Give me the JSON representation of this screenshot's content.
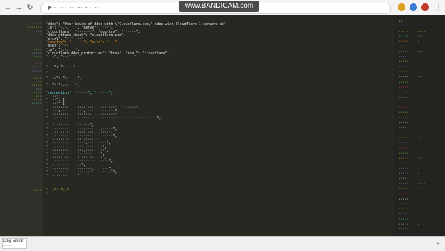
{
  "browser": {
    "back_icon": "back-arrow-icon",
    "forward_icon": "forward-arrow-icon",
    "reload_icon": "reload-icon",
    "address": "▶   ·   ··· ·· ······· ·· ·· ···",
    "watermark": "www.BANDICAM.com",
    "menu_label": "⋮",
    "ext_colors": [
      "#e0a020",
      "#3b78d8",
      "#c0392b"
    ]
  },
  "editor": {
    "background": "#272822",
    "lines": [
      {
        "num": "",
        "key": "",
        "key_color": "#a6e22e",
        "text": "{",
        "text_color": "#e6e6e6"
      },
      {
        "num": "",
        "key": "····",
        "key_color": "#a6e22e",
        "text": "\"ddos\": \"Your house of ddos with \\\"Cloudflare.com\\\" ddos with Cloudflare 1 servers at\"",
        "text_color": "#e6e6e6"
      },
      {
        "num": "",
        "key": "·······",
        "key_color": "#a6e22e",
        "text": "  \"ip\": \"·.·.·.·\", \"server\": \"··\",",
        "text_color": "#e6e6e6"
      },
      {
        "num": "",
        "key": "···",
        "key_color": "#66d9ef",
        "text": "\"cloudflare\": \"·······\", \"country\": \"······\",",
        "text_color": "#e6e6e6"
      },
      {
        "num": "",
        "key": "··",
        "key_color": "#66d9ef",
        "text": "\"ddos_attack_check\": \"cloudflare.com\",",
        "text_color": "#e6e6e6"
      },
      {
        "num": "",
        "key": "",
        "key_color": "#a6e22e",
        "text": "\"proxy\": \"·······\"",
        "text_color": "#e6e6e6"
      },
      {
        "num": "",
        "key": "···",
        "key_color": "#f92672",
        "text": "\"country\": \"······\", \"city\": \"···\",",
        "text_color": "#fd971f"
      },
      {
        "num": "",
        "key": "",
        "key_color": "#a6e22e",
        "text": "\"user\": \"····\",",
        "text_color": "#e6e6e6"
      },
      {
        "num": "",
        "key": "····",
        "key_color": "#a6e22e",
        "text": "\"ip\": \"·.·.·.·\",",
        "text_color": "#e6e6e6"
      },
      {
        "num": "",
        "key": "·····",
        "key_color": "#66d9ef",
        "text": "\"cloudflare_ddos_protection\": \"true\", \"cdn_\": \"cloudflare\",",
        "text_color": "#e6e6e6"
      },
      {
        "num": "",
        "key": "····",
        "key_color": "#a6e22e",
        "text": "\"···\": \"·····\"",
        "text_color": "#e6e6e6"
      },
      {
        "num": "",
        "key": "",
        "key_color": "#a6e22e",
        "text": "",
        "text_color": "#e6e6e6"
      },
      {
        "num": "",
        "key": "···",
        "key_color": "#f92672",
        "text": "",
        "text_color": "#e6e6e6"
      },
      {
        "num": "",
        "key": "······",
        "key_color": "#ae81ff",
        "text": "\"···\": \"·····\"",
        "text_color": "#e6e6e6"
      },
      {
        "num": "",
        "key": "·····",
        "key_color": "#ae81ff",
        "text": "},",
        "text_color": "#e6e6e6"
      },
      {
        "num": "",
        "key": "",
        "key_color": "#a6e22e",
        "text": "",
        "text_color": "#e6e6e6"
      },
      {
        "num": "",
        "key": "····",
        "key_color": "#a6e22e",
        "text": "\"····\": \"······\",",
        "text_color": "#e6e6e6"
      },
      {
        "num": "",
        "key": "··",
        "key_color": "#a6e22e",
        "text": "",
        "text_color": "#e6e6e6"
      },
      {
        "num": "",
        "key": "·····",
        "key_color": "#a6e22e",
        "text": "\"··\": \"·······\",",
        "text_color": "#e6e6e6"
      },
      {
        "num": "",
        "key": "···",
        "key_color": "#66d9ef",
        "text": "",
        "text_color": "#e6e6e6"
      },
      {
        "num": "",
        "key": "····",
        "key_color": "#a6e22e",
        "text": "\"connection\": \"·····\", \"······\",",
        "text_color": "#66d9ef"
      },
      {
        "num": "",
        "key": "···",
        "key_color": "#a6e22e",
        "text": "\"····\",",
        "text_color": "#e6e6e6"
      },
      {
        "num": "",
        "key": "····",
        "key_color": "#a6e22e",
        "text": "\"····\": [",
        "text_color": "#e6e6e6"
      },
      {
        "num": "",
        "key": "·····",
        "key_color": "#66d9ef",
        "text": "  \"····\": [",
        "text_color": "#e6e6e6"
      },
      {
        "num": "",
        "key": "",
        "key_color": "#a6e22e",
        "text": "    \"··········.·······.·········.···\", \"······\",",
        "text_color": "#e6e6e6"
      },
      {
        "num": "",
        "key": "",
        "key_color": "#a6e22e",
        "text": "    \"·····: ·· ··  ····, ·····  ·······\",",
        "text_color": "#e6e6e6"
      },
      {
        "num": "",
        "key": "",
        "key_color": "#a6e22e",
        "text": "    \"··········.··········.··········\",",
        "text_color": "#e6e6e6"
      },
      {
        "num": "",
        "key": "",
        "key_color": "#a6e22e",
        "text": "    \"·· ·· · ······· ···· ··· ··· ·········· · ······ ···\",",
        "text_color": "#e6e6e6"
      },
      {
        "num": "",
        "key": "",
        "key_color": "#a6e22e",
        "text": "",
        "text_color": "#e6e6e6"
      },
      {
        "num": "",
        "key": "",
        "key_color": "#a6e22e",
        "text": "    \"··· ··· ···· ··· ···\",",
        "text_color": "#e6e6e6"
      },
      {
        "num": "",
        "key": "",
        "key_color": "#a6e22e",
        "text": "    \"··········.······.·······.·····\",",
        "text_color": "#e6e6e6"
      },
      {
        "num": "",
        "key": "",
        "key_color": "#a6e22e",
        "text": "    \"·· ·· ·· ···· ···· ··· ······\",",
        "text_color": "#e6e6e6"
      },
      {
        "num": "",
        "key": "",
        "key_color": "#a6e22e",
        "text": "    \"·· · ····· ··· ······ ··· ·····\",",
        "text_color": "#e6e6e6"
      },
      {
        "num": "",
        "key": "",
        "key_color": "#a6e22e",
        "text": "    \"··· ···· ··· ··· ······\",",
        "text_color": "#e6e6e6"
      },
      {
        "num": "",
        "key": "",
        "key_color": "#a6e22e",
        "text": "    \"··········.·······.·········\",",
        "text_color": "#e6e6e6"
      },
      {
        "num": "",
        "key": "",
        "key_color": "#a6e22e",
        "text": "    \"·· ·· ·· ···· ··· ········\",",
        "text_color": "#e6e6e6"
      },
      {
        "num": "",
        "key": "",
        "key_color": "#a6e22e",
        "text": "    \"··········.······.·········\",",
        "text_color": "#e6e6e6"
      },
      {
        "num": "",
        "key": "",
        "key_color": "#a6e22e",
        "text": "    \"· ··· ·· ···· ·· ···· ···\",",
        "text_color": "#e6e6e6"
      },
      {
        "num": "",
        "key": "",
        "key_color": "#a6e22e",
        "text": "    \"······· ·· ···· ··· ······\",",
        "text_color": "#e6e6e6"
      },
      {
        "num": "",
        "key": "",
        "key_color": "#a6e22e",
        "text": "    \"·· ····· ·· ········ ········\",",
        "text_color": "#e6e6e6"
      },
      {
        "num": "",
        "key": "",
        "key_color": "#a6e22e",
        "text": "    \"··· ·· ····· ···\",",
        "text_color": "#e6e6e6"
      },
      {
        "num": "",
        "key": "",
        "key_color": "#a6e22e",
        "text": "    \"··········.··········.··· ···\",",
        "text_color": "#e6e6e6"
      },
      {
        "num": "",
        "key": "",
        "key_color": "#a6e22e",
        "text": "    \"·· ····· ····· ·· ···· ·· ·· ··\",",
        "text_color": "#e6e6e6"
      },
      {
        "num": "",
        "key": "",
        "key_color": "#a6e22e",
        "text": "    \"··· ·· ·· ····\"",
        "text_color": "#e6e6e6"
      },
      {
        "num": "",
        "key": "",
        "key_color": "#a6e22e",
        "text": "  ]",
        "text_color": "#e6e6e6"
      },
      {
        "num": "",
        "key": "",
        "key_color": "#a6e22e",
        "text": "]",
        "text_color": "#e6e6e6"
      },
      {
        "num": "",
        "key": "",
        "key_color": "#a6e22e",
        "text": "",
        "text_color": "#e6e6e6"
      },
      {
        "num": "",
        "key": "····",
        "key_color": "#a6e22e",
        "text": "\"···\": \"··\",",
        "text_color": "#a6e22e"
      },
      {
        "num": "",
        "key": "",
        "key_color": "#a6e22e",
        "text": "}",
        "text_color": "#e6e6e6"
      }
    ]
  },
  "minimap": {
    "rows": [
      {
        "text": "··",
        "color": "#ffffff"
      },
      {
        "text": "····",
        "color": "#f92672"
      },
      {
        "text": "··· ··· ·····",
        "color": "#a6e22e"
      },
      {
        "text": "·· ···· ···",
        "color": "#66d9ef"
      },
      {
        "text": "······· ··",
        "color": "#fd971f"
      },
      {
        "text": "···· ··",
        "color": "#f92672"
      },
      {
        "text": "····· ·· ···",
        "color": "#e6db74"
      },
      {
        "text": "···· ··",
        "color": "#ae81ff"
      },
      {
        "text": "·······",
        "color": "#a6e22e"
      },
      {
        "text": "·· ·····",
        "color": "#66d9ef"
      },
      {
        "text": "····· ····",
        "color": "#fd971f"
      },
      {
        "text": "········ ··",
        "color": "#ffffff"
      },
      {
        "text": "······",
        "color": "#a6e22e"
      },
      {
        "text": "·····",
        "color": "#f92672"
      },
      {
        "text": "· ····",
        "color": "#66d9ef"
      },
      {
        "text": "······",
        "color": "#e6db74"
      },
      {
        "text": "",
        "color": "#ffffff"
      },
      {
        "text": "·····",
        "color": "#f92672"
      },
      {
        "text": "·········",
        "color": "#a6e22e"
      },
      {
        "text": "········· ··",
        "color": "#fd971f"
      },
      {
        "text": "········",
        "color": "#ffffff"
      },
      {
        "text": "····",
        "color": "#e6db74"
      },
      {
        "text": "",
        "color": "#ffffff"
      },
      {
        "text": "······ ····",
        "color": "#a6e22e"
      },
      {
        "text": "······· ·",
        "color": "#66d9ef"
      },
      {
        "text": "········",
        "color": "#f92672"
      },
      {
        "text": "····· ·",
        "color": "#a6e22e"
      },
      {
        "text": "··· ·······",
        "color": "#fd971f"
      },
      {
        "text": "······· ·",
        "color": "#f92672"
      },
      {
        "text": "·······",
        "color": "#ae81ff"
      },
      {
        "text": "··· ······",
        "color": "#66d9ef"
      },
      {
        "text": "····",
        "color": "#e6db74"
      },
      {
        "text": "····· · ·····",
        "color": "#ffffff"
      },
      {
        "text": "······ ···",
        "color": "#a6e22e"
      },
      {
        "text": "···· ··",
        "color": "#f92672"
      },
      {
        "text": "·······",
        "color": "#ffffff"
      },
      {
        "text": "······ ·",
        "color": "#fd971f"
      },
      {
        "text": "··· ·····",
        "color": "#a6e22e"
      },
      {
        "text": "···· ····",
        "color": "#ae81ff"
      },
      {
        "text": "·········",
        "color": "#66d9ef"
      },
      {
        "text": "··· ·· ···",
        "color": "#e6db74"
      },
      {
        "text": "····· ···",
        "color": "#ffffff"
      }
    ]
  },
  "status": {
    "download_label": "Dbg Editor\n······",
    "close_label": "×"
  }
}
